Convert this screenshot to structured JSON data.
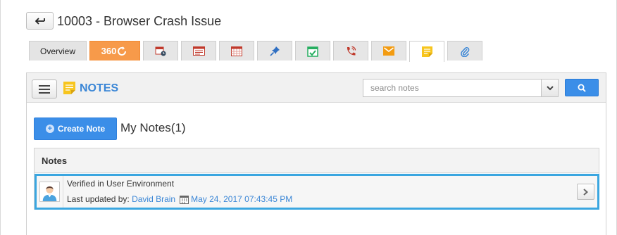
{
  "header": {
    "title": "10003 - Browser Crash Issue"
  },
  "tabs": [
    {
      "label": "Overview",
      "icon": "overview"
    },
    {
      "label": "360",
      "icon": "refresh-icon"
    },
    {
      "label": "",
      "icon": "calendar-clock-icon"
    },
    {
      "label": "",
      "icon": "list-document-icon"
    },
    {
      "label": "",
      "icon": "calendar-grid-icon"
    },
    {
      "label": "",
      "icon": "pin-icon"
    },
    {
      "label": "",
      "icon": "task-check-icon"
    },
    {
      "label": "",
      "icon": "phone-call-icon"
    },
    {
      "label": "",
      "icon": "email-icon"
    },
    {
      "label": "",
      "icon": "notes-icon",
      "active": true
    },
    {
      "label": "",
      "icon": "paperclip-icon"
    }
  ],
  "panel": {
    "title": "NOTES",
    "search": {
      "placeholder": "search notes",
      "value": ""
    },
    "create_label": "Create Note",
    "list_heading": "My Notes(1)",
    "table_header": "Notes",
    "notes": [
      {
        "text": "Verified in User Environment",
        "updated_label": "Last updated by:",
        "author": "David Brain",
        "date": "May 24, 2017 07:43:45 PM"
      }
    ]
  },
  "colors": {
    "accent": "#3b8ee8",
    "tab360": "#f79a4a",
    "link": "#3a86d6",
    "selected_border": "#3aa6e0"
  }
}
